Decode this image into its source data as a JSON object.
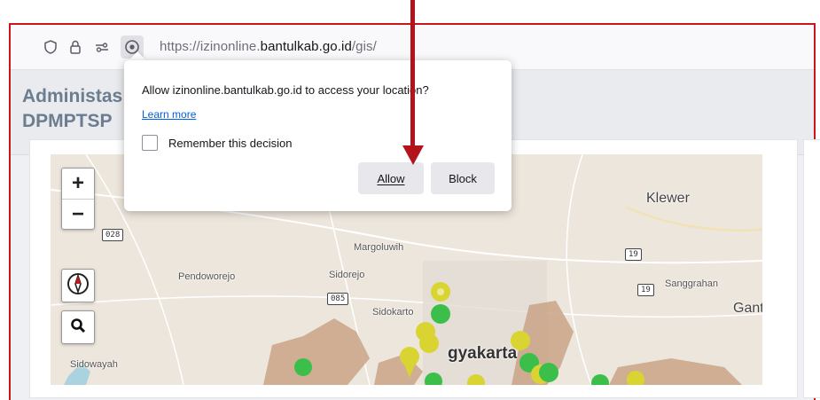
{
  "browser": {
    "url_prefix": "https://izinonline.",
    "url_domain": "bantulkab.go.id",
    "url_path": "/gis/",
    "icons": [
      "shield-icon",
      "lock-icon",
      "permissions-icon",
      "location-icon"
    ]
  },
  "page": {
    "title_line1": "Administas",
    "title_line2": "DPMPTSP"
  },
  "permission_popup": {
    "question": "Allow izinonline.bantulkab.go.id to access your location?",
    "learn_more": "Learn more",
    "remember_label": "Remember this decision",
    "remember_checked": false,
    "allow_label": "Allow",
    "block_label": "Block"
  },
  "map": {
    "controls": {
      "zoom_in": "+",
      "zoom_out": "−"
    },
    "labels": {
      "klewer": "Klewer",
      "margoluwih": "Margoluwih",
      "pendoworejo": "Pendoworejo",
      "sidorejo": "Sidorejo",
      "sidokarto": "Sidokarto",
      "sanggrahan": "Sanggrahan",
      "gant": "Gant",
      "sidowayah": "Sidowayah",
      "yogyakarta": "gyakarta",
      "road_028": "028",
      "road_085": "085",
      "road_19a": "19",
      "road_19b": "19"
    },
    "colors": {
      "region": "#c9a387",
      "marker_green": "#3cbf4a",
      "marker_yellow": "#d9d431"
    }
  },
  "annotation": {
    "color": "#b3141b"
  }
}
